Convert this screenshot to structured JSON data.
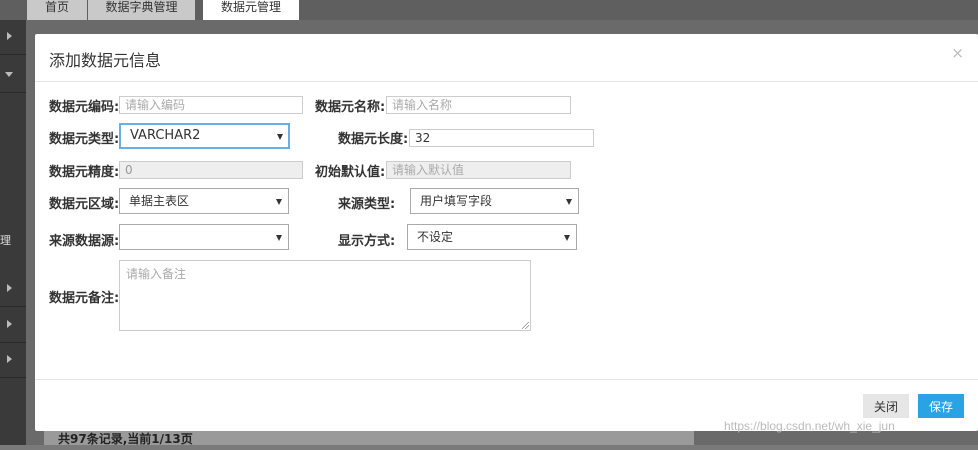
{
  "tabs": [
    {
      "label": "首页"
    },
    {
      "label": "数据字典管理"
    },
    {
      "label": "数据元管理"
    }
  ],
  "nav": {
    "partial_text": "理"
  },
  "footer_text": "共97条记录,当前1/13页",
  "modal": {
    "title": "添加数据元信息",
    "close_symbol": "×",
    "fields": {
      "code": {
        "label": "数据元编码:",
        "placeholder": "请输入编码"
      },
      "name": {
        "label": "数据元名称:",
        "placeholder": "请输入名称"
      },
      "type": {
        "label": "数据元类型:",
        "value": "VARCHAR2"
      },
      "length": {
        "label": "数据元长度:",
        "value": "32"
      },
      "precision": {
        "label": "数据元精度:",
        "value": "0"
      },
      "default": {
        "label": "初始默认值:",
        "placeholder": "请输入默认值"
      },
      "area": {
        "label": "数据元区域:",
        "value": "单据主表区"
      },
      "source_type": {
        "label": "来源类型:",
        "value": "用户填写字段"
      },
      "source_datasource": {
        "label": "来源数据源:",
        "value": ""
      },
      "display_mode": {
        "label": "显示方式:",
        "value": "不设定"
      },
      "remark": {
        "label": "数据元备注:",
        "placeholder": "请输入备注"
      }
    },
    "buttons": {
      "close": "关闭",
      "save": "保存"
    }
  },
  "watermark": "https://blog.csdn.net/wh_xie_jun"
}
